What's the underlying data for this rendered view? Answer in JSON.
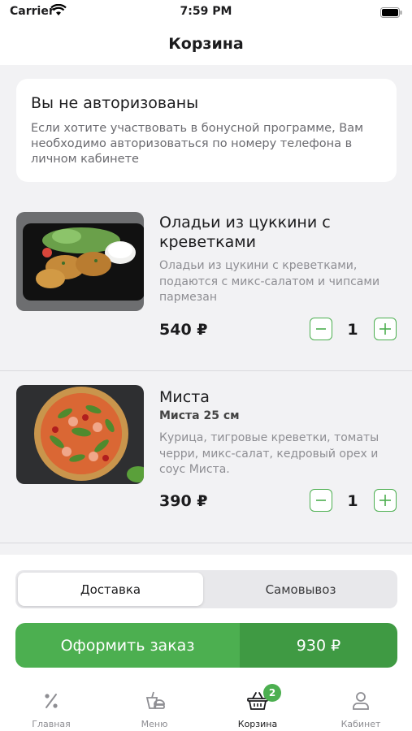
{
  "status_bar": {
    "carrier": "Carrier",
    "time": "7:59 PM"
  },
  "nav": {
    "title": "Корзина"
  },
  "auth_notice": {
    "title": "Вы не авторизованы",
    "text": "Если хотите участвовать в бонусной программе, Вам необходимо авторизоваться по номеру телефона в личном кабинете"
  },
  "cart": {
    "items": [
      {
        "name": "Оладьи из цуккини с креветками",
        "description": "Оладьи из цукини с креветками, подаются с микс-салатом и чипсами пармезан",
        "price": "540 ₽",
        "quantity": "1"
      },
      {
        "name": "Миста",
        "size": "Миста 25 см",
        "description": "Курица, тигровые креветки, томаты черри, микс-салат, кедровый орех и соус Миста.",
        "price": "390 ₽",
        "quantity": "1"
      }
    ]
  },
  "delivery": {
    "options": [
      "Доставка",
      "Самовывоз"
    ],
    "selected": "Доставка"
  },
  "checkout": {
    "label": "Оформить заказ",
    "total": "930 ₽"
  },
  "tabbar": {
    "items": [
      {
        "label": "Главная",
        "icon": "percent-icon"
      },
      {
        "label": "Меню",
        "icon": "menu-food-icon"
      },
      {
        "label": "Корзина",
        "icon": "basket-icon",
        "badge": "2"
      },
      {
        "label": "Кабинет",
        "icon": "user-icon"
      }
    ]
  },
  "colors": {
    "accent": "#4caf50",
    "accent_dark": "#3f9a43",
    "background": "#f2f2f4"
  }
}
